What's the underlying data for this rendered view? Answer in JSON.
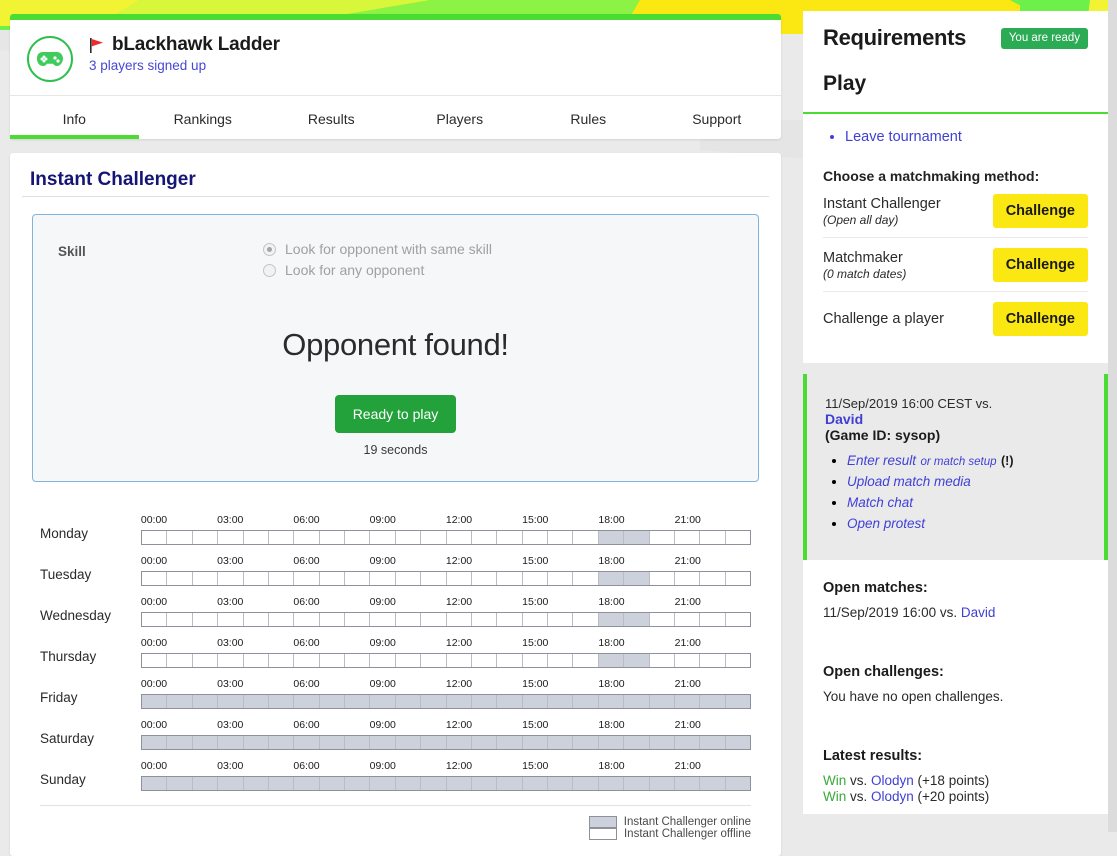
{
  "colors": {
    "brand_green": "#4BDC34",
    "accent_yellow": "#FBE712",
    "badge_green": "#2cab55",
    "ready_button_green": "#23a13a",
    "link_blue": "#3f3fd4",
    "heading_navy": "#151575",
    "page_background": "#eaeaea",
    "schedule_online": "#ccd1dc",
    "win_green": "#3aa93a"
  },
  "tournament": {
    "logo_icon": "gamepad-icon",
    "flag_icon": "red-flag-icon",
    "name": "bLackhawk Ladder",
    "signups": "3 players signed up"
  },
  "tabs": [
    {
      "label": "Info",
      "active": true
    },
    {
      "label": "Rankings",
      "active": false
    },
    {
      "label": "Results",
      "active": false
    },
    {
      "label": "Players",
      "active": false
    },
    {
      "label": "Rules",
      "active": false
    },
    {
      "label": "Support",
      "active": false
    }
  ],
  "instant_challenger": {
    "heading": "Instant Challenger",
    "skill_label": "Skill",
    "options": [
      {
        "label": "Look for opponent with same skill",
        "selected": true
      },
      {
        "label": "Look for any opponent",
        "selected": false
      }
    ],
    "status": "Opponent found!",
    "ready_button": "Ready to play",
    "countdown": "19 seconds"
  },
  "schedule": {
    "tick_labels": [
      "00:00",
      "03:00",
      "06:00",
      "09:00",
      "12:00",
      "15:00",
      "18:00",
      "21:00"
    ],
    "tick_hours": [
      0,
      3,
      6,
      9,
      12,
      15,
      18,
      21
    ],
    "hours_per_day": 24,
    "legend": [
      {
        "state": "on",
        "label": "Instant Challenger online"
      },
      {
        "state": "off",
        "label": "Instant Challenger offline"
      }
    ],
    "days": [
      {
        "name": "Monday",
        "online_hours": [
          18,
          19
        ]
      },
      {
        "name": "Tuesday",
        "online_hours": [
          18,
          19
        ]
      },
      {
        "name": "Wednesday",
        "online_hours": [
          18,
          19
        ]
      },
      {
        "name": "Thursday",
        "online_hours": [
          18,
          19
        ]
      },
      {
        "name": "Friday",
        "online_hours": [
          0,
          1,
          2,
          3,
          4,
          5,
          6,
          7,
          8,
          9,
          10,
          11,
          12,
          13,
          14,
          15,
          16,
          17,
          18,
          19,
          20,
          21,
          22,
          23
        ]
      },
      {
        "name": "Saturday",
        "online_hours": [
          0,
          1,
          2,
          3,
          4,
          5,
          6,
          7,
          8,
          9,
          10,
          11,
          12,
          13,
          14,
          15,
          16,
          17,
          18,
          19,
          20,
          21,
          22,
          23
        ]
      },
      {
        "name": "Sunday",
        "online_hours": [
          0,
          1,
          2,
          3,
          4,
          5,
          6,
          7,
          8,
          9,
          10,
          11,
          12,
          13,
          14,
          15,
          16,
          17,
          18,
          19,
          20,
          21,
          22,
          23
        ]
      }
    ]
  },
  "sidebar": {
    "requirements_title": "Requirements",
    "ready_badge": "You are ready",
    "play_title": "Play",
    "leave_link": "Leave tournament",
    "matchmaking_heading": "Choose a matchmaking method:",
    "matchmaking_rows": [
      {
        "label": "Instant Challenger",
        "sub": "(Open all day)",
        "button": "Challenge"
      },
      {
        "label": "Matchmaker",
        "sub": "(0 match dates)",
        "button": "Challenge"
      },
      {
        "label": "Challenge a player",
        "sub": "",
        "button": "Challenge"
      }
    ],
    "current_match": {
      "when": "11/Sep/2019 16:00 CEST vs.",
      "opponent": "David",
      "game_id": "(Game ID: sysop)",
      "links": [
        {
          "text": "Enter result",
          "small": "or match setup",
          "flag": "(!)"
        },
        {
          "text": "Upload match media",
          "small": "",
          "flag": ""
        },
        {
          "text": "Match chat",
          "small": "",
          "flag": ""
        },
        {
          "text": "Open protest",
          "small": "",
          "flag": ""
        }
      ]
    },
    "open_matches": {
      "title": "Open matches:",
      "entry_prefix": "11/Sep/2019 16:00 vs.",
      "entry_opponent": "David"
    },
    "open_challenges": {
      "title": "Open challenges:",
      "body": "You have no open challenges."
    },
    "latest_results": {
      "title": "Latest results:",
      "items": [
        {
          "outcome": "Win",
          "vs": "vs.",
          "opponent": "Olodyn",
          "points": "(+18 points)"
        },
        {
          "outcome": "Win",
          "vs": "vs.",
          "opponent": "Olodyn",
          "points": "(+20 points)"
        }
      ]
    }
  }
}
